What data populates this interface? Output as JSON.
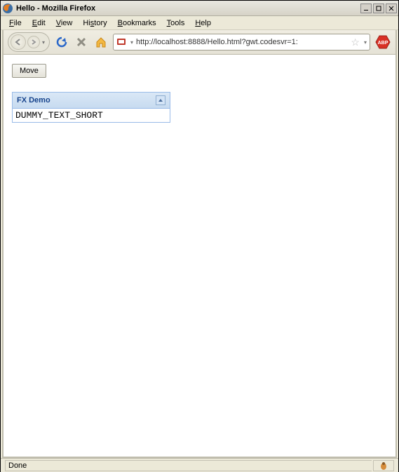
{
  "window": {
    "title": "Hello - Mozilla Firefox"
  },
  "menubar": {
    "file": "File",
    "edit": "Edit",
    "view": "View",
    "history": "History",
    "bookmarks": "Bookmarks",
    "tools": "Tools",
    "help": "Help"
  },
  "toolbar": {
    "url": "http://localhost:8888/Hello.html?gwt.codesvr=1:"
  },
  "page": {
    "move_button": "Move",
    "panel_title": "FX Demo",
    "panel_content": "DUMMY_TEXT_SHORT"
  },
  "statusbar": {
    "status": "Done"
  }
}
